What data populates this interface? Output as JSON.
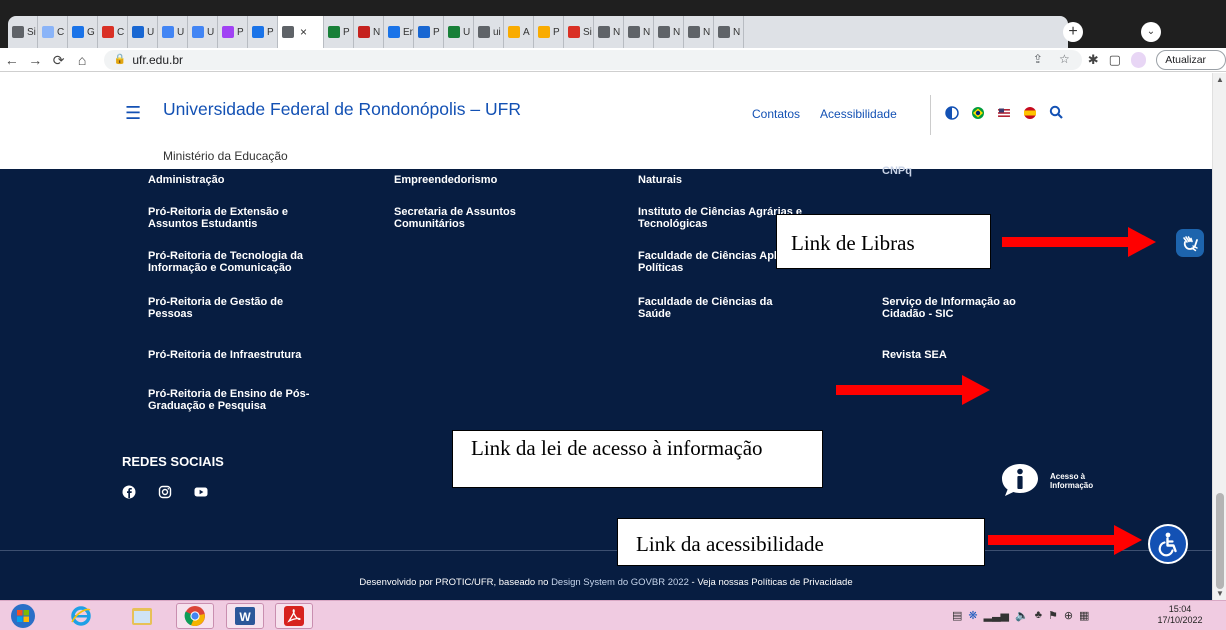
{
  "browser": {
    "tabs": [
      {
        "label": "Si",
        "color": "#5f6368",
        "active": false
      },
      {
        "label": "C",
        "color": "#8ab4f8",
        "active": false
      },
      {
        "label": "G",
        "color": "#1a73e8",
        "active": false
      },
      {
        "label": "C",
        "color": "#d93025",
        "active": false
      },
      {
        "label": "U",
        "color": "#1967d2",
        "active": false
      },
      {
        "label": "U",
        "color": "#4285f4",
        "active": false
      },
      {
        "label": "U",
        "color": "#4285f4",
        "active": false
      },
      {
        "label": "P",
        "color": "#a142f4",
        "active": false
      },
      {
        "label": "P",
        "color": "#1a73e8",
        "active": false
      },
      {
        "label": "",
        "color": "#5f6368",
        "active": true
      },
      {
        "label": "P",
        "color": "#188038",
        "active": false
      },
      {
        "label": "N",
        "color": "#c5221f",
        "active": false
      },
      {
        "label": "Er",
        "color": "#1a73e8",
        "active": false
      },
      {
        "label": "P",
        "color": "#1967d2",
        "active": false
      },
      {
        "label": "U",
        "color": "#188038",
        "active": false
      },
      {
        "label": "ui",
        "color": "#5f6368",
        "active": false
      },
      {
        "label": "A",
        "color": "#f9ab00",
        "active": false
      },
      {
        "label": "P",
        "color": "#f9ab00",
        "active": false
      },
      {
        "label": "Si",
        "color": "#d93025",
        "active": false
      },
      {
        "label": "N",
        "color": "#5f6368",
        "active": false
      },
      {
        "label": "N",
        "color": "#5f6368",
        "active": false
      },
      {
        "label": "N",
        "color": "#5f6368",
        "active": false
      },
      {
        "label": "N",
        "color": "#5f6368",
        "active": false
      },
      {
        "label": "N",
        "color": "#5f6368",
        "active": false
      }
    ],
    "url": "ufr.edu.br",
    "update_label": "Atualizar"
  },
  "header": {
    "title": "Universidade Federal de Rondonópolis – UFR",
    "subtitle": "Ministério da Educação",
    "links": [
      "Contatos",
      "Acessibilidade"
    ]
  },
  "footer": {
    "columns": [
      [
        "Administração",
        "Pró-Reitoria de Extensão e Assuntos Estudantis",
        "Pró-Reitoria de Tecnologia da Informação e Comunicação",
        "Pró-Reitoria de Gestão de Pessoas",
        "Pró-Reitoria de Infraestrutura",
        "Pró-Reitoria de Ensino de Pós-Graduação e Pesquisa"
      ],
      [
        "Empreendedorismo",
        "Secretaria de Assuntos Comunitários"
      ],
      [
        "Naturais",
        "Instituto de Ciências Agrárias e Tecnológicas",
        "Faculdade de Ciências Aplicadas e Políticas",
        "Faculdade de Ciências da Saúde"
      ],
      [
        "CNPq",
        "Serviço de Informação ao Cidadão - SIC",
        "Revista SEA"
      ]
    ],
    "social_title": "REDES SOCIAIS",
    "lai_text": "Acesso à Informação",
    "credits_plain": "Desenvolvido por PROTIC/UFR, baseado no ",
    "credits_link": "Design System do GOVBR 2022",
    "credits_sep": " - ",
    "credits_policy": "Veja nossas Políticas de Privacidade"
  },
  "annotations": {
    "libras": "Link de Libras",
    "lai": "Link da lei de acesso à informação",
    "accessibility": "Link da acessibilidade"
  },
  "colors": {
    "footer_bg": "#071d41",
    "brand_blue": "#1351b4",
    "arrow_red": "#ff0000",
    "taskbar_bg": "#f0cbe1"
  },
  "taskbar": {
    "time": "15:04",
    "date": "17/10/2022"
  }
}
